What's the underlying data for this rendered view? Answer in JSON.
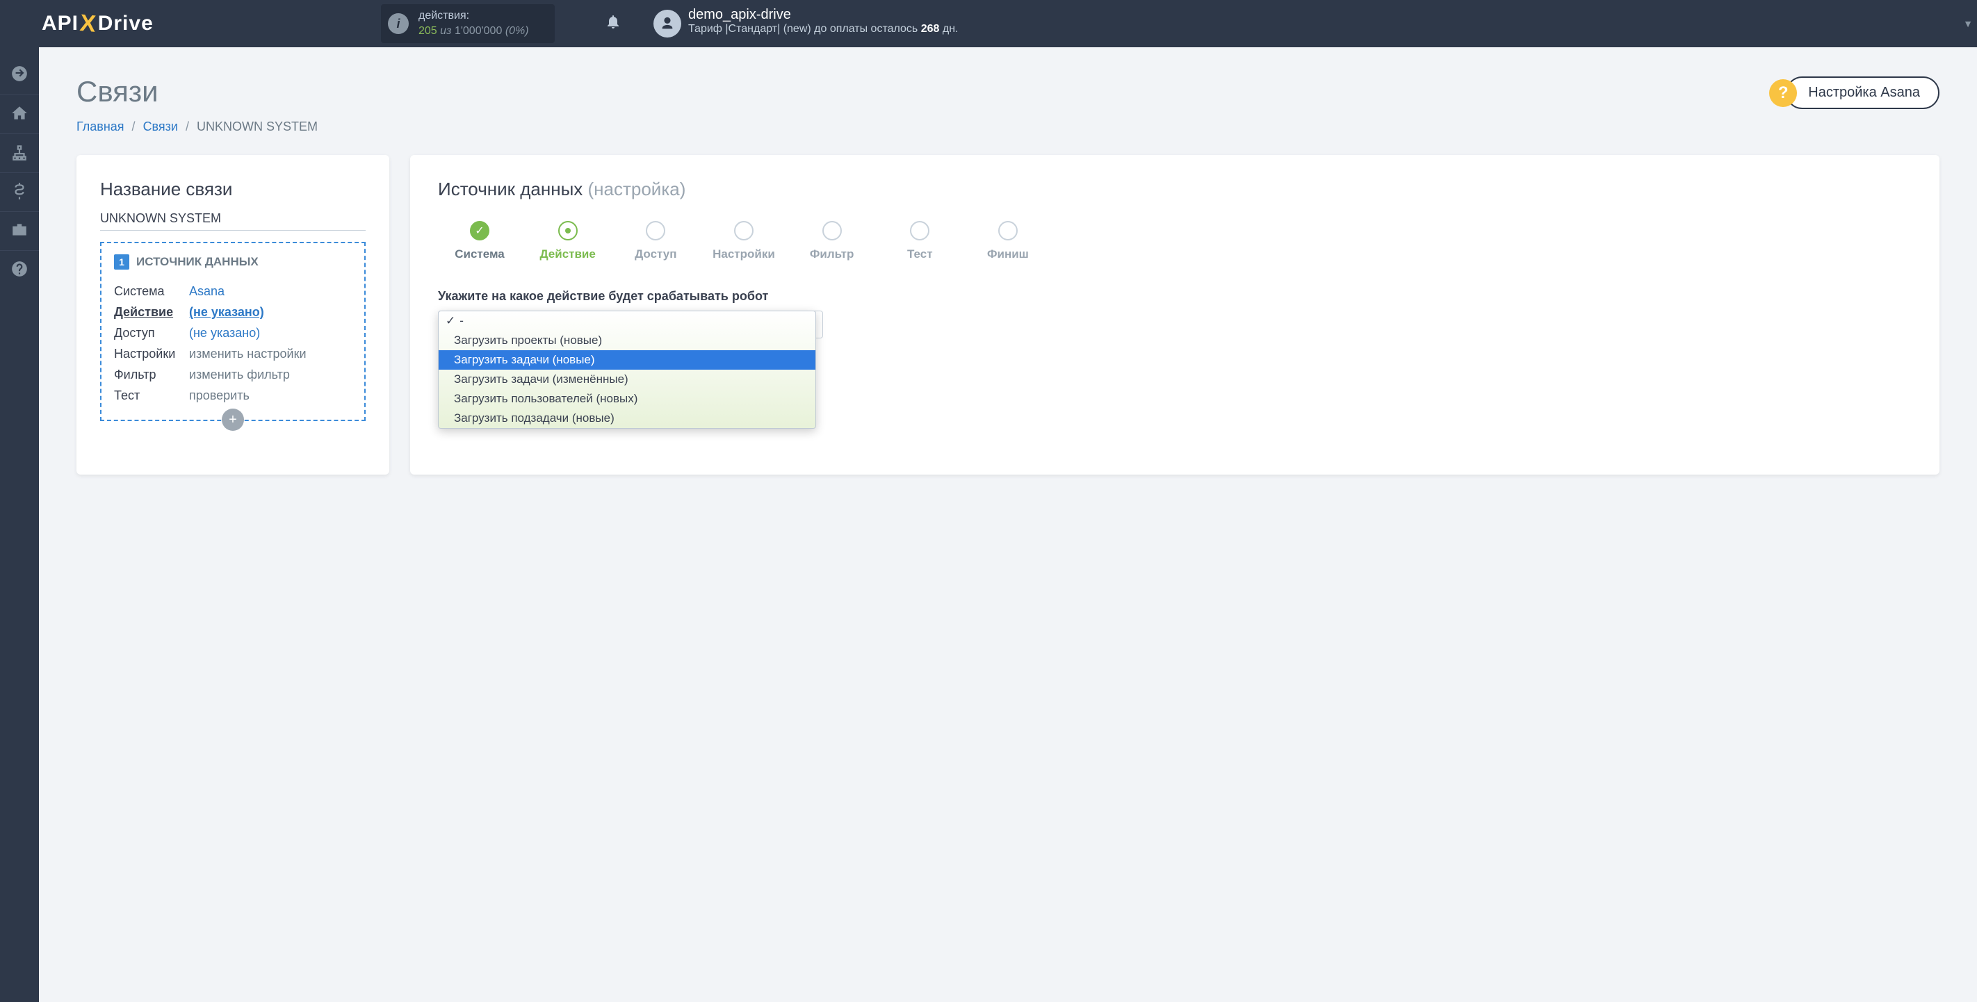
{
  "header": {
    "logo_part1": "API",
    "logo_x": "X",
    "logo_part2": "Drive",
    "stats_label": "действия:",
    "stats_used": "205",
    "stats_of_word": "из",
    "stats_total": "1'000'000",
    "stats_pct": "(0%)",
    "username": "demo_apix-drive",
    "tariff_prefix": "Тариф |Стандарт| (new) до оплаты осталось ",
    "tariff_days": "268",
    "tariff_suffix": " дн."
  },
  "page": {
    "title": "Связи",
    "crumb1": "Главная",
    "crumb2": "Связи",
    "crumb3": "UNKNOWN SYSTEM",
    "help_label": "Настройка Asana"
  },
  "left_panel": {
    "heading": "Название связи",
    "subname": "UNKNOWN SYSTEM",
    "box_header": "ИСТОЧНИК ДАННЫХ",
    "badge": "1",
    "rows": {
      "system_k": "Система",
      "system_v": "Asana",
      "action_k": "Действие",
      "action_v": "(не указано)",
      "access_k": "Доступ",
      "access_v": "(не указано)",
      "settings_k": "Настройки",
      "settings_v": "изменить настройки",
      "filter_k": "Фильтр",
      "filter_v": "изменить фильтр",
      "test_k": "Тест",
      "test_v": "проверить"
    }
  },
  "right_panel": {
    "heading_main": "Источник данных ",
    "heading_sub": "(настройка)",
    "steps": [
      "Система",
      "Действие",
      "Доступ",
      "Настройки",
      "Фильтр",
      "Тест",
      "Финиш"
    ],
    "field_label": "Укажите на какое действие будет срабатывать робот",
    "selected": "-",
    "options": [
      "-",
      "Загрузить проекты (новые)",
      "Загрузить задачи (новые)",
      "Загрузить задачи (изменённые)",
      "Загрузить пользователей (новых)",
      "Загрузить подзадачи (новые)"
    ],
    "highlighted_index": 2
  }
}
